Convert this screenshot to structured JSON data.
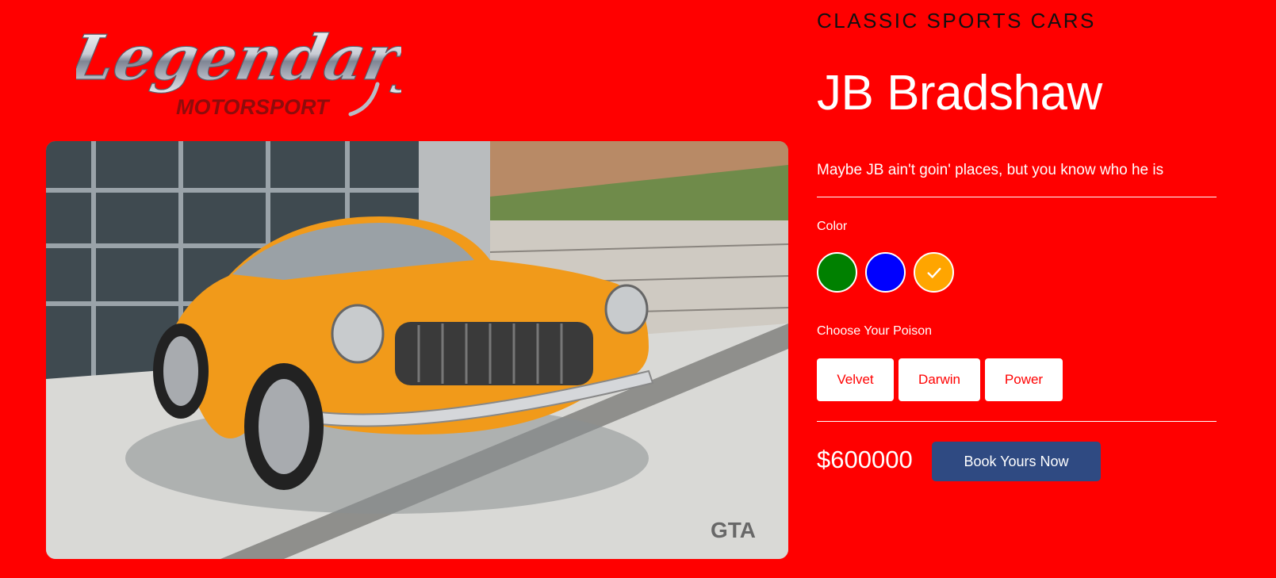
{
  "brand": {
    "logo_script": "Legendary",
    "logo_sub": "MOTORSPORT"
  },
  "product": {
    "category": "CLASSIC SPORTS CARS",
    "name": "JB Bradshaw",
    "description": "Maybe JB ain't goin' places, but you know who he is",
    "price": "$600000",
    "photo_watermark": "GTA"
  },
  "color_section": {
    "label": "Color",
    "swatches": [
      {
        "name": "green",
        "hex": "#008000",
        "selected": false
      },
      {
        "name": "blue",
        "hex": "#0000ff",
        "selected": false
      },
      {
        "name": "orange",
        "hex": "#ffa500",
        "selected": true
      }
    ],
    "selected_icon": "check-icon"
  },
  "options_section": {
    "label": "Choose Your Poison",
    "options": [
      "Velvet",
      "Darwin",
      "Power"
    ]
  },
  "cta": {
    "label": "Book Yours Now"
  }
}
